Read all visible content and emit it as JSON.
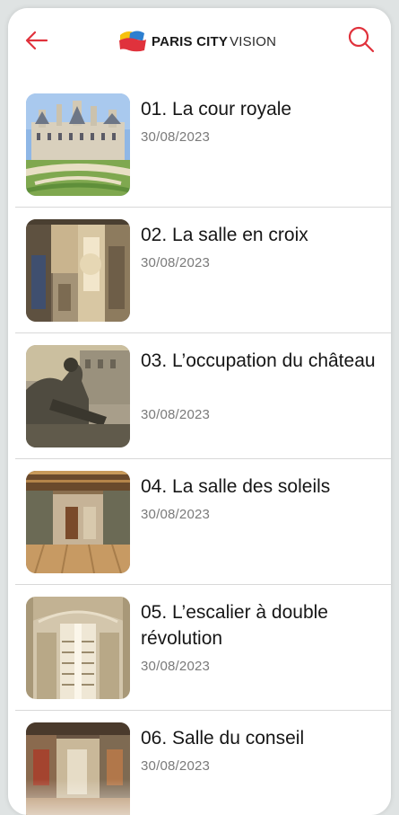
{
  "header": {
    "back_icon": "arrow-left-icon",
    "search_icon": "search-icon",
    "logo": {
      "bold_text": "PARIS CITY",
      "light_text": "VISION"
    },
    "accent_color": "#e0323c"
  },
  "items": [
    {
      "title": "01. La cour royale",
      "date": "30/08/2023"
    },
    {
      "title": "02. La salle en croix",
      "date": "30/08/2023"
    },
    {
      "title": "03. L’occupation du château",
      "date": "30/08/2023"
    },
    {
      "title": "04. La salle des soleils",
      "date": "30/08/2023"
    },
    {
      "title": "05. L’escalier à double révolution",
      "date": "30/08/2023"
    },
    {
      "title": "06. Salle du conseil",
      "date": "30/08/2023"
    }
  ]
}
